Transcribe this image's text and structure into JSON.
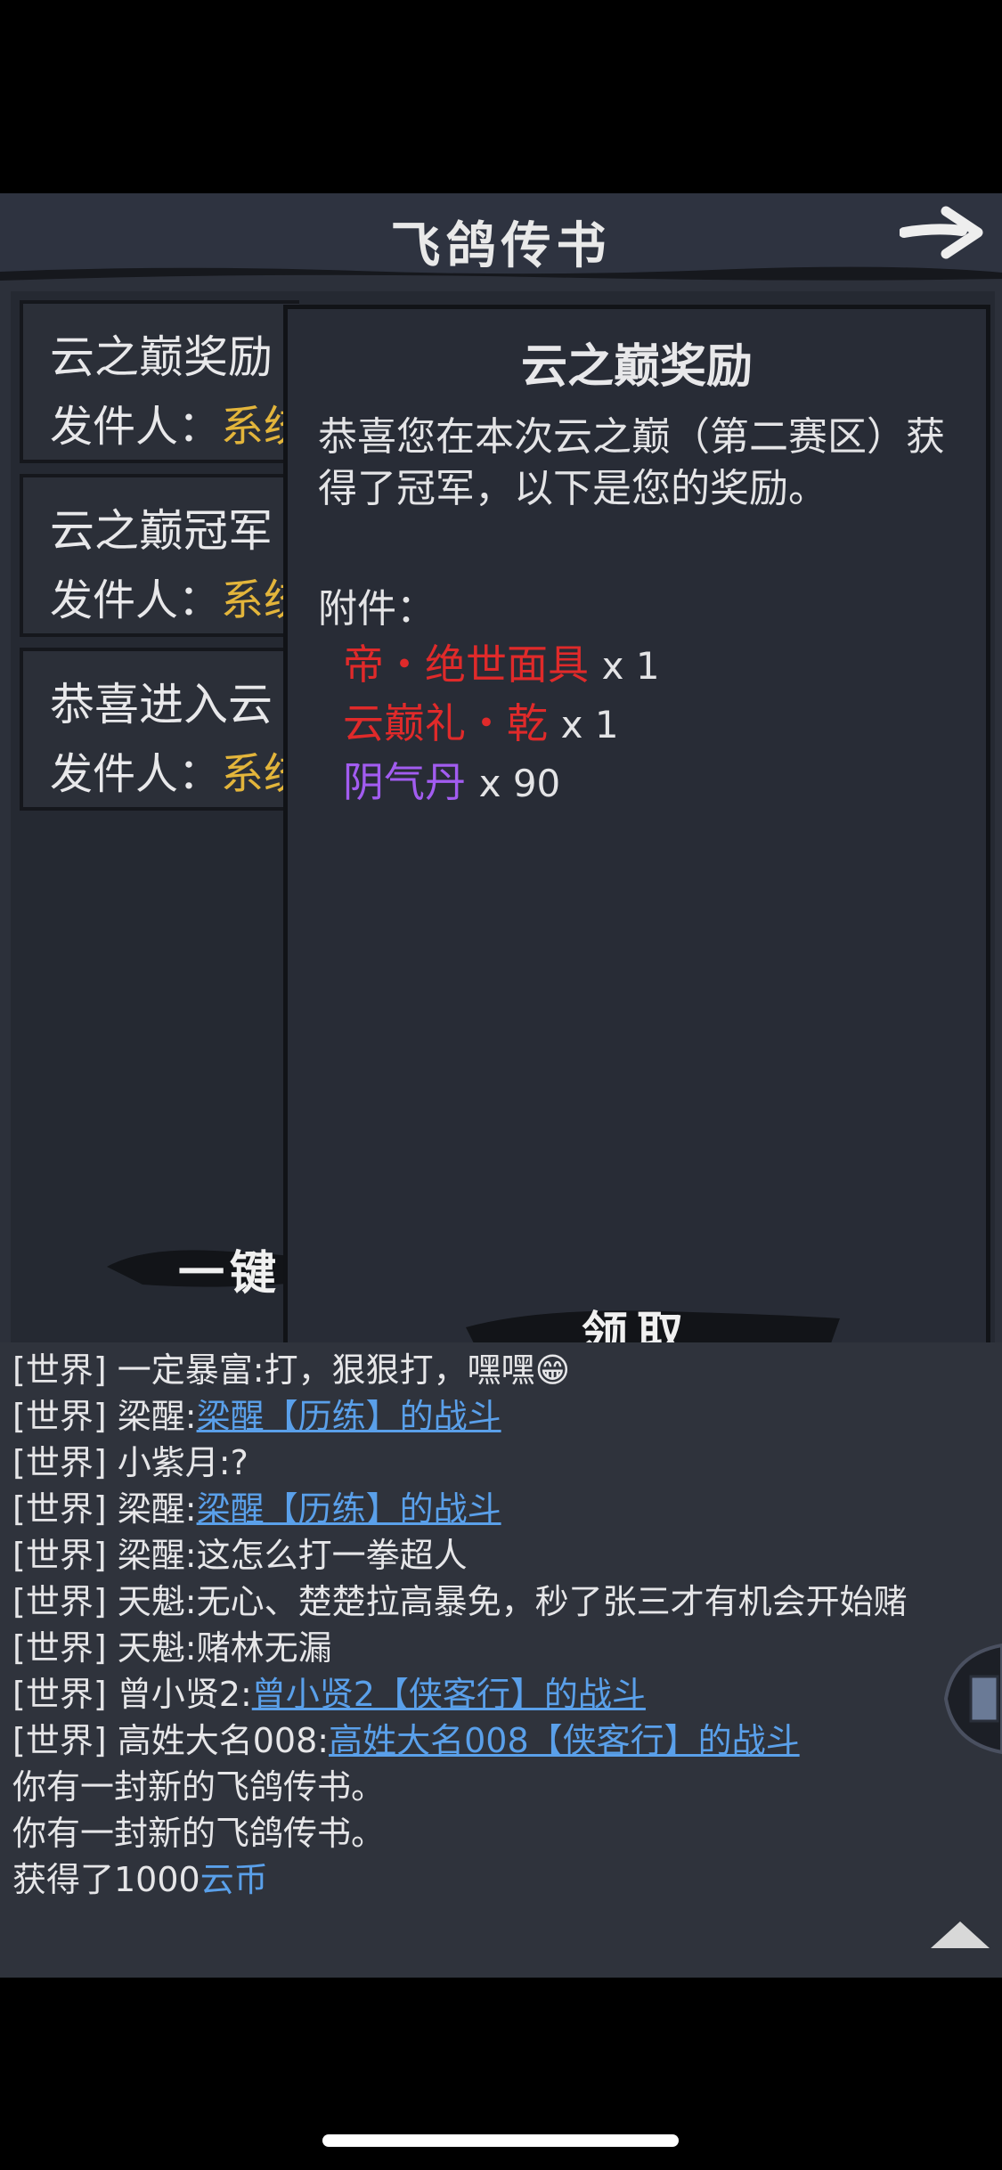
{
  "header": {
    "title": "飞鸽传书"
  },
  "mail_list": {
    "items": [
      {
        "subject": "云之巅奖励",
        "from_label": "发件人：",
        "from_name": "系统"
      },
      {
        "subject": "云之巅冠军",
        "from_label": "发件人：",
        "from_name": "系统"
      },
      {
        "subject": "恭喜进入云",
        "from_label": "发件人：",
        "from_name": "系统"
      }
    ],
    "claim_all_label": "一键"
  },
  "detail": {
    "title": "云之巅奖励",
    "body": "恭喜您在本次云之巅（第二赛区）获得了冠军，以下是您的奖励。",
    "attach_label": "附件：",
    "attachments": [
      {
        "name": "帝・绝世面具",
        "qty": "x 1",
        "color": "#e02a2a"
      },
      {
        "name": "云巅礼・乾",
        "qty": "x 1",
        "color": "#e02a2a"
      },
      {
        "name": "阴气丹",
        "qty": "x 90",
        "color": "#a25cf0"
      }
    ],
    "claim_label": "领取"
  },
  "chat": {
    "lines": [
      {
        "tag": "[世界]",
        "speaker": "一定暴富",
        "text": ":打，狠狠打，嘿嘿😁",
        "link": ""
      },
      {
        "tag": "[世界]",
        "speaker": "梁醒",
        "text": ":",
        "link": "梁醒【历练】的战斗"
      },
      {
        "tag": "[世界]",
        "speaker": "小紫月",
        "text": ":?",
        "link": ""
      },
      {
        "tag": "[世界]",
        "speaker": "梁醒",
        "text": ":",
        "link": "梁醒【历练】的战斗"
      },
      {
        "tag": "[世界]",
        "speaker": "梁醒",
        "text": ":这怎么打一拳超人",
        "link": ""
      },
      {
        "tag": "[世界]",
        "speaker": "天魁",
        "text": ":无心、楚楚拉高暴免，秒了张三才有机会开始赌",
        "link": ""
      },
      {
        "tag": "[世界]",
        "speaker": "天魁",
        "text": ":赌林无漏",
        "link": ""
      },
      {
        "tag": "[世界]",
        "speaker": "曾小贤2",
        "text": ":",
        "link": "曾小贤2【侠客行】的战斗"
      },
      {
        "tag": "[世界]",
        "speaker": "高姓大名008",
        "text": ":",
        "link": "高姓大名008【侠客行】的战斗"
      }
    ],
    "system": [
      "你有一封新的飞鸽传书。",
      "你有一封新的飞鸽传书。"
    ],
    "gain_prefix": "获得了1000",
    "gain_coin": "云币"
  },
  "colors": {
    "system_name": "#e3b53b",
    "link": "#5aa0ea"
  }
}
